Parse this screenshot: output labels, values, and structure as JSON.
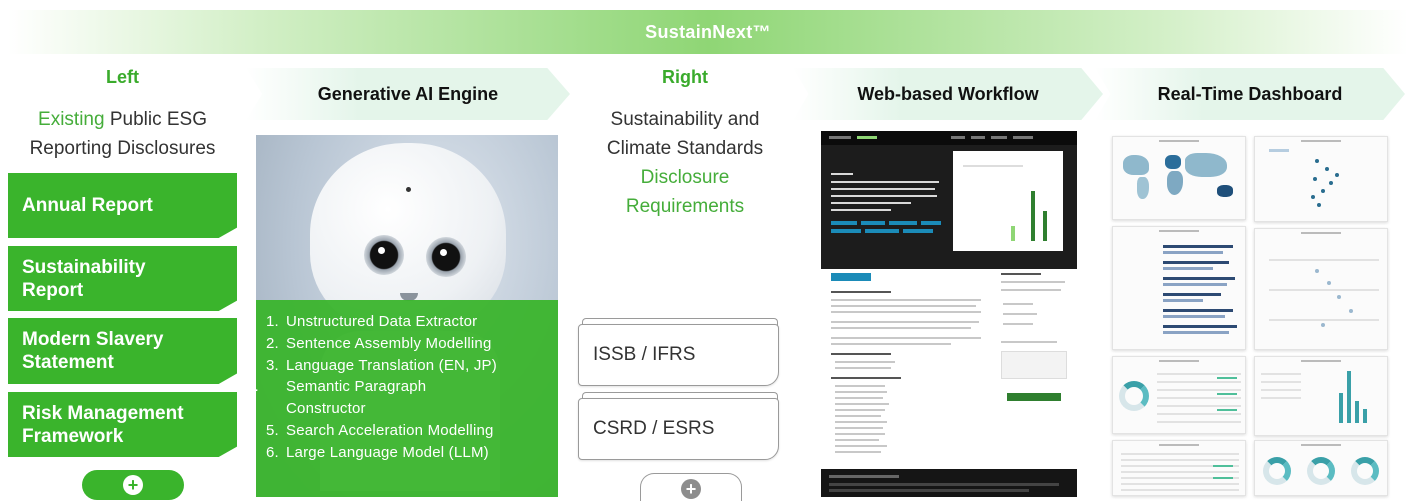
{
  "banner": {
    "title": "SustainNext™"
  },
  "left": {
    "title": "Left",
    "lead_highlight": "Existing",
    "lead_rest_1": " Public ESG",
    "lead_rest_2": "Reporting Disclosures",
    "documents": [
      {
        "label": "Annual Report"
      },
      {
        "label_1": "Sustainability",
        "label_2": "Report"
      },
      {
        "label_1": "Modern Slavery",
        "label_2": "Statement"
      },
      {
        "label_1": "Risk Management",
        "label_2": "Framework"
      }
    ],
    "add_icon": "plus-icon"
  },
  "engine": {
    "title": "Generative AI Engine",
    "photo": "robot-photo",
    "steps": [
      {
        "num": "1.",
        "text": "Unstructured Data Extractor"
      },
      {
        "num": "2.",
        "text": "Sentence Assembly Modelling"
      },
      {
        "num": "3.",
        "text": "Language Translation (EN, JP)"
      },
      {
        "num": "4.",
        "text": "Semantic Paragraph Constructor"
      },
      {
        "num": "5.",
        "text": "Search Acceleration Modelling"
      },
      {
        "num": "6.",
        "text": "Large Language Model (LLM)"
      }
    ]
  },
  "right": {
    "title": "Right",
    "lead_1": "Sustainability and",
    "lead_2": "Climate Standards",
    "lead_highlight_1": "Disclosure",
    "lead_highlight_2": "Requirements",
    "standards": [
      "ISSB / IFRS",
      "CSRD / ESRS"
    ],
    "add_icon": "plus-icon"
  },
  "workflow": {
    "title": "Web-based Workflow"
  },
  "dashboard": {
    "title": "Real-Time Dashboard"
  },
  "colors": {
    "accent_green": "#3ab42c",
    "text_green": "#45ad3a",
    "chevron_fill": "#e4f5ea",
    "banner_green": "#8fd675"
  }
}
